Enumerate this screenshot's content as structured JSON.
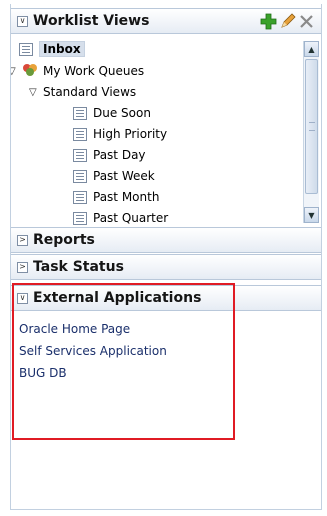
{
  "worklist_views": {
    "title": "Worklist Views",
    "tree": {
      "inbox": "Inbox",
      "my_work_queues": "My Work Queues",
      "standard_views": "Standard Views",
      "items": [
        "Due Soon",
        "High Priority",
        "Past Day",
        "Past Week",
        "Past Month",
        "Past Quarter"
      ]
    }
  },
  "reports": {
    "title": "Reports"
  },
  "task_status": {
    "title": "Task Status"
  },
  "external_applications": {
    "title": "External Applications",
    "links": [
      "Oracle Home Page",
      "Self Services Application",
      "BUG DB"
    ]
  },
  "colors": {
    "highlight_border": "#e01b24",
    "link": "#1a2f6b",
    "add_icon": "#3aa12b"
  }
}
